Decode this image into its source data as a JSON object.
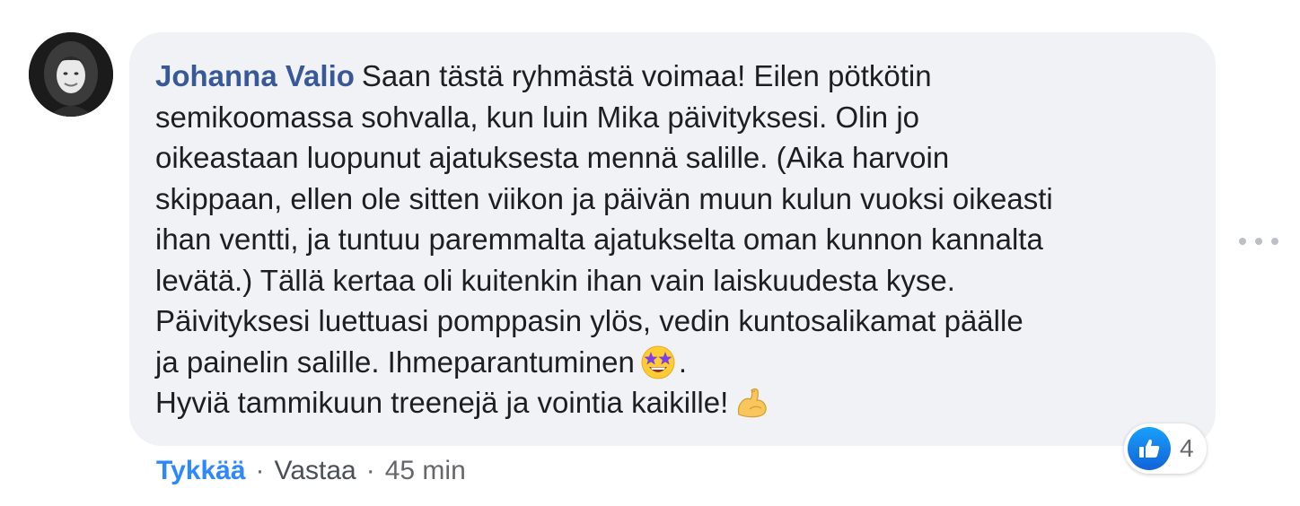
{
  "comment": {
    "author": "Johanna Valio",
    "lines": [
      "Saan tästä ryhmästä voimaa! Eilen pötkötin",
      "semikoomassa sohvalla, kun luin Mika päivityksesi. Olin jo",
      "oikeastaan luopunut ajatuksesta mennä salille. (Aika harvoin",
      "skippaan, ellen ole sitten viikon ja päivän muun kulun vuoksi oikeasti",
      "ihan ventti, ja tuntuu paremmalta ajatukselta oman kunnon kannalta",
      "levätä.) Tällä kertaa oli kuitenkin ihan vain laiskuudesta kyse.",
      "Päivityksesi luettuasi pomppasin ylös, vedin kuntosalikamat päälle",
      "ja painelin salille. Ihmeparantuminen",
      ".",
      "Hyviä tammikuun treenejä ja vointia kaikille!"
    ],
    "emojis": [
      "star-struck-emoji",
      "flexed-biceps-emoji"
    ]
  },
  "reactions": {
    "icon": "thumbs-up-icon",
    "count": "4"
  },
  "actions": {
    "like": "Tykkää",
    "separator": "·",
    "reply": "Vastaa",
    "timestamp": "45 min"
  },
  "colors": {
    "author": "#385898",
    "bubble": "#f0f2f5",
    "like_link": "#2d88ff",
    "meta": "#65676b"
  }
}
